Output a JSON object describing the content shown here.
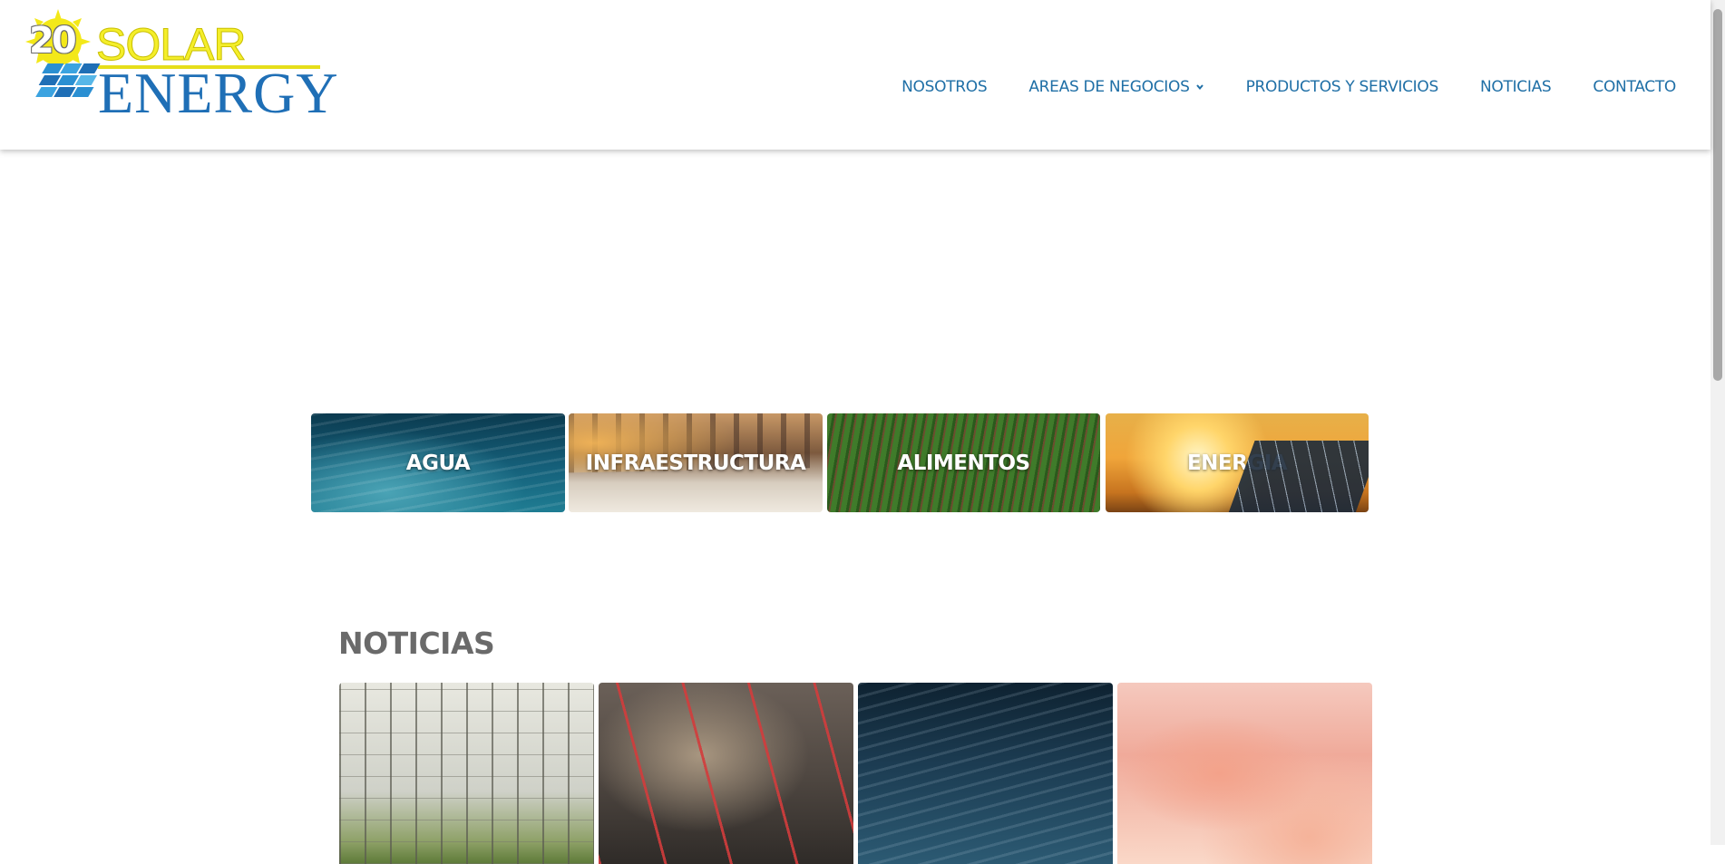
{
  "brand": {
    "logo_number": "20",
    "logo_word_1": "SOLAR",
    "logo_word_2": "ENERGY",
    "colors": {
      "yellow": "#f4ee2a",
      "blue": "#1f6fb6",
      "nav": "#1f6fa6"
    }
  },
  "nav": {
    "items": [
      {
        "label": "NOSOTROS"
      },
      {
        "label": "AREAS DE NEGOCIOS",
        "icon": "chevron-down-icon"
      },
      {
        "label": "PRODUCTOS Y SERVICIOS"
      },
      {
        "label": "NOTICIAS"
      },
      {
        "label": "CONTACTO"
      }
    ]
  },
  "areas": {
    "cards": [
      {
        "label": "AGUA"
      },
      {
        "label": "INFRAESTRUCTURA"
      },
      {
        "label": "ALIMENTOS"
      },
      {
        "label": "ENERGIA"
      }
    ]
  },
  "news": {
    "title": "NOTICIAS",
    "cards": [
      {
        "image": "greenhouse-photo"
      },
      {
        "image": "construction-site-aerial-photo"
      },
      {
        "image": "ocean-water-photo"
      },
      {
        "image": "pink-clouds-photo"
      }
    ]
  }
}
